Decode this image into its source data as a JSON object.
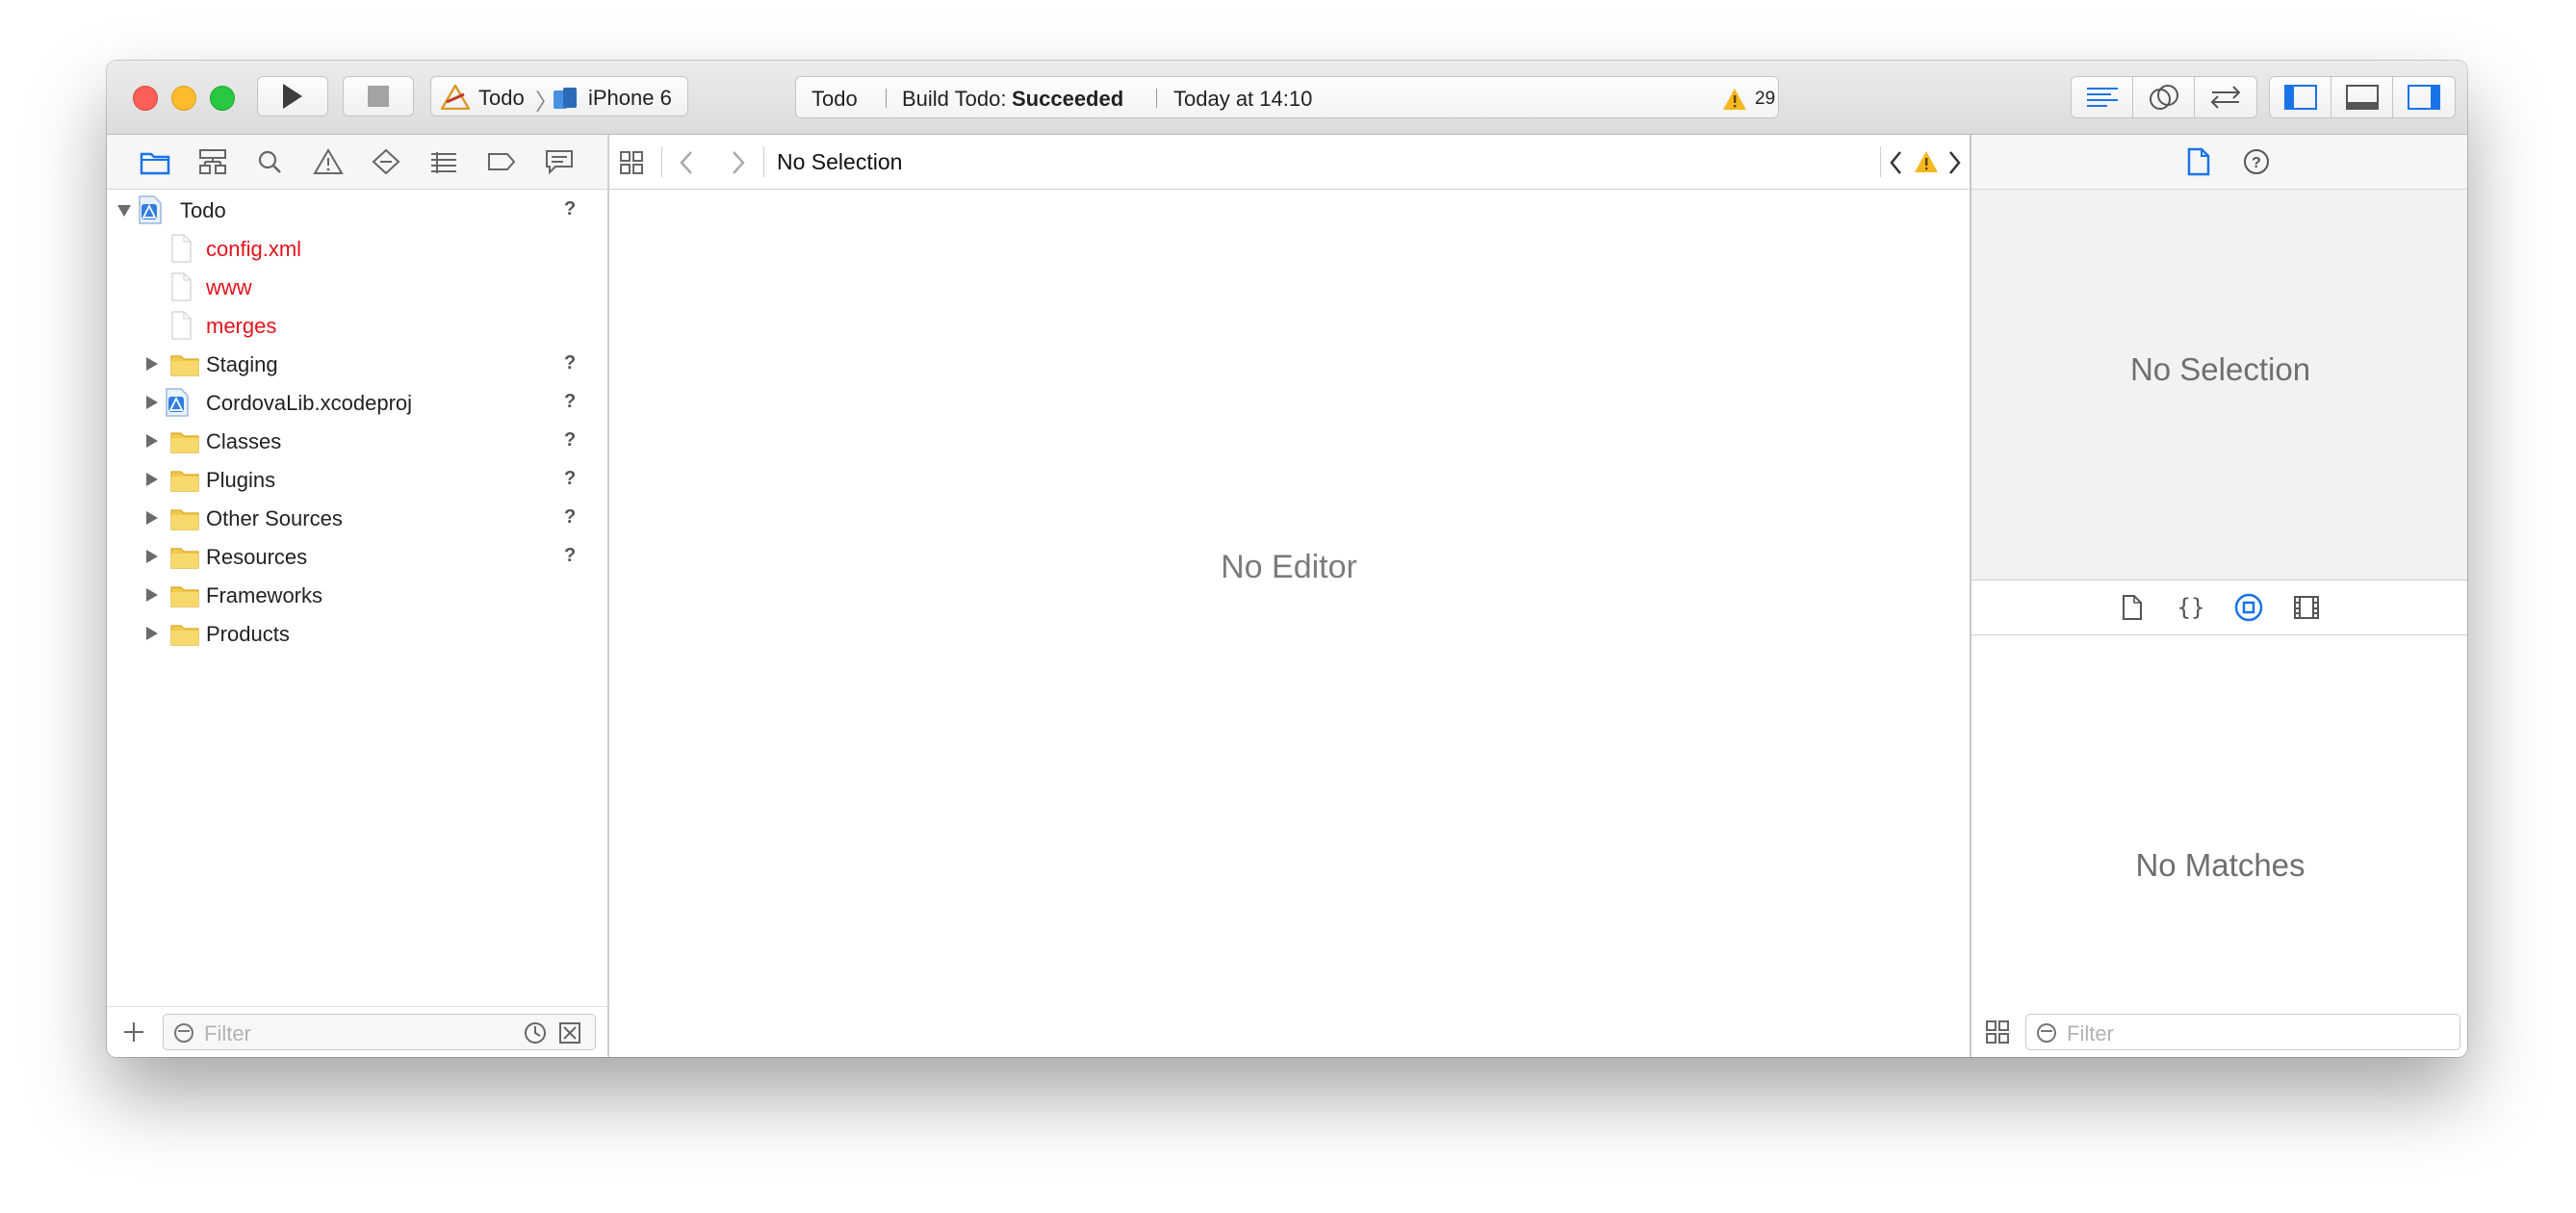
{
  "toolbar": {
    "scheme_project": "Todo",
    "scheme_device": "iPhone 6",
    "activity_project": "Todo",
    "activity_build_prefix": "Build Todo:",
    "activity_build_status": "Succeeded",
    "activity_time": "Today at 14:10",
    "warning_count": "29"
  },
  "navigator": {
    "tabs": [
      "folder-icon",
      "hierarchy-icon",
      "search-icon",
      "warning-icon",
      "test-diamond-icon",
      "debug-list-icon",
      "breakpoint-icon",
      "report-bubble-icon"
    ],
    "tree": [
      {
        "name": "Todo",
        "kind": "project",
        "level": 0,
        "expanded": true,
        "status": "?"
      },
      {
        "name": "config.xml",
        "kind": "file",
        "level": 1,
        "missing": true,
        "status": ""
      },
      {
        "name": "www",
        "kind": "file",
        "level": 1,
        "missing": true,
        "status": ""
      },
      {
        "name": "merges",
        "kind": "file",
        "level": 1,
        "missing": true,
        "status": ""
      },
      {
        "name": "Staging",
        "kind": "folder",
        "level": 1,
        "status": "?"
      },
      {
        "name": "CordovaLib.xcodeproj",
        "kind": "project",
        "level": 1,
        "status": "?"
      },
      {
        "name": "Classes",
        "kind": "folder",
        "level": 1,
        "status": "?"
      },
      {
        "name": "Plugins",
        "kind": "folder",
        "level": 1,
        "status": "?"
      },
      {
        "name": "Other Sources",
        "kind": "folder",
        "level": 1,
        "status": "?"
      },
      {
        "name": "Resources",
        "kind": "folder",
        "level": 1,
        "status": "?"
      },
      {
        "name": "Frameworks",
        "kind": "folder",
        "level": 1,
        "status": ""
      },
      {
        "name": "Products",
        "kind": "folder",
        "level": 1,
        "status": ""
      }
    ],
    "filter_placeholder": "Filter"
  },
  "editor": {
    "jump_bar_title": "No Selection",
    "empty_text": "No Editor"
  },
  "inspector": {
    "upper_empty_text": "No Selection",
    "lower_empty_text": "No Matches",
    "filter_placeholder": "Filter"
  },
  "colors": {
    "accent": "#1a73e8",
    "missing_file": "#e3131c",
    "warning": "#f5b820"
  }
}
